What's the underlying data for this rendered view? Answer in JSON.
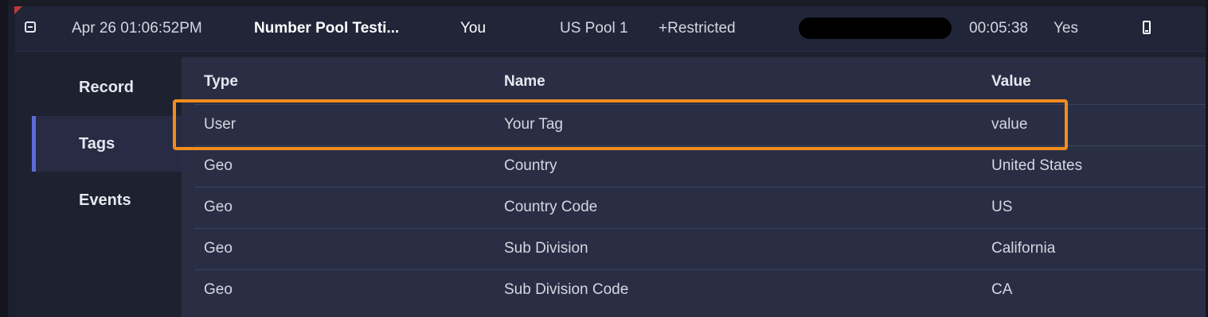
{
  "row": {
    "datetime": "Apr 26 01:06:52PM",
    "campaign": "Number Pool Testi...",
    "owner": "You",
    "pool": "US Pool 1",
    "restriction": "+Restricted",
    "duration": "00:05:38",
    "answered": "Yes",
    "icons": {
      "collapse": "minus-square-icon",
      "device": "mobile-phone-icon"
    }
  },
  "nav": {
    "items": [
      {
        "label": "Record",
        "active": false
      },
      {
        "label": "Tags",
        "active": true
      },
      {
        "label": "Events",
        "active": false
      }
    ]
  },
  "tags_table": {
    "headers": {
      "type": "Type",
      "name": "Name",
      "value": "Value"
    },
    "rows": [
      {
        "type": "User",
        "name": "Your Tag",
        "value": "value"
      },
      {
        "type": "Geo",
        "name": "Country",
        "value": "United States"
      },
      {
        "type": "Geo",
        "name": "Country Code",
        "value": "US"
      },
      {
        "type": "Geo",
        "name": "Sub Division",
        "value": "California"
      },
      {
        "type": "Geo",
        "name": "Sub Division Code",
        "value": "CA"
      }
    ]
  },
  "colors": {
    "highlight": "#f28c1e",
    "nav_active_accent": "#5b6bd6",
    "flag": "#c0393b"
  }
}
